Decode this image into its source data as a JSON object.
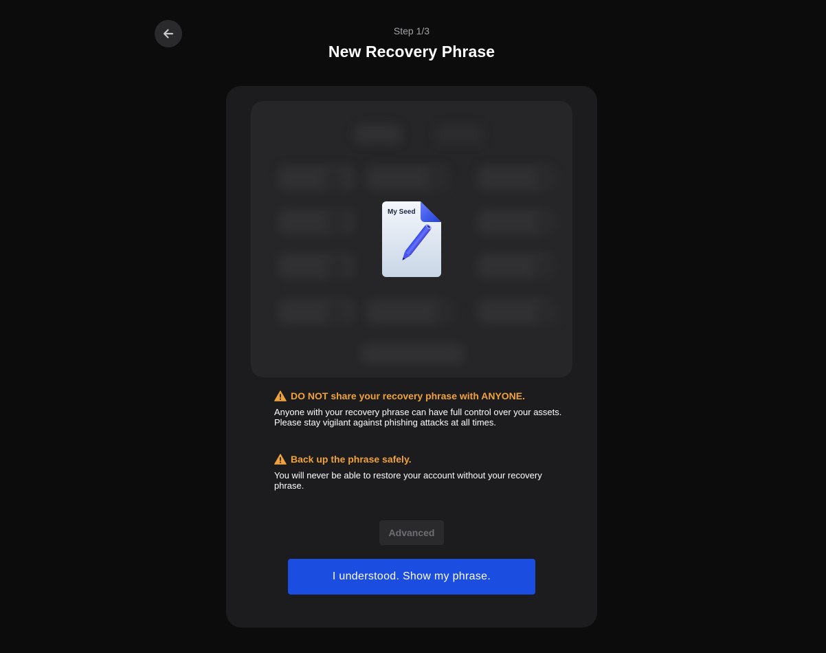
{
  "header": {
    "step": "Step 1/3",
    "title": "New Recovery Phrase"
  },
  "preview": {
    "doc_label": "My Seed"
  },
  "warnings": [
    {
      "title": "DO NOT share your recovery phrase with ANYONE.",
      "body": "Anyone with your recovery phrase can have full control over your assets. Please stay vigilant against phishing attacks at all times."
    },
    {
      "title": "Back up the phrase safely.",
      "body": "You will never be able to restore your account without your recovery phrase."
    }
  ],
  "buttons": {
    "advanced": "Advanced",
    "primary": "I understood. Show my phrase."
  },
  "colors": {
    "background": "#0c0c0c",
    "card": "#1c1c1e",
    "warning": "#f0a23a",
    "primary": "#1a4de0"
  },
  "icons": {
    "back": "arrow-left-icon",
    "warning": "warning-triangle-icon",
    "document": "seed-document-pencil-icon"
  }
}
